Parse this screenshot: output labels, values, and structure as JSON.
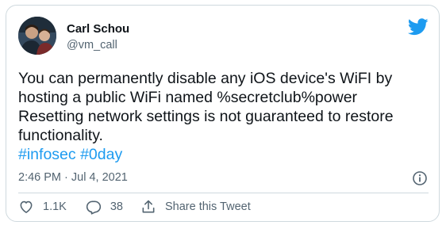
{
  "author": {
    "name": "Carl Schou",
    "handle": "@vm_call"
  },
  "tweet": {
    "lines": [
      "You can permanently disable any iOS device's WiFI by",
      "hosting a public WiFi named %secretclub%power",
      "Resetting network settings is not guaranteed to restore",
      "functionality."
    ],
    "hashtags": [
      "#infosec",
      "#0day"
    ],
    "timestamp": "2:46 PM · Jul 4, 2021"
  },
  "actions": {
    "likes": "1.1K",
    "replies": "38",
    "share_label": "Share this Tweet"
  },
  "colors": {
    "brand": "#1d9bf0",
    "text": "#0f1419",
    "secondary": "#536471",
    "border": "#cfd9de"
  },
  "icons": {
    "logo": "twitter-bird-icon",
    "info": "info-icon",
    "like": "heart-icon",
    "reply": "reply-icon",
    "share": "share-icon"
  }
}
